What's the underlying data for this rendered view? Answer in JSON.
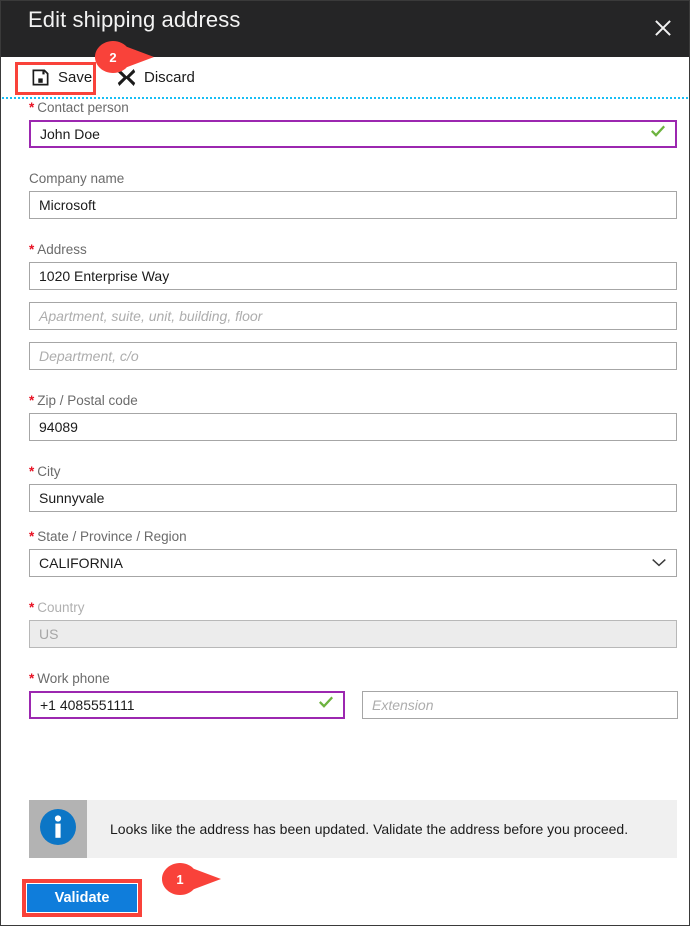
{
  "window": {
    "title": "Edit shipping address",
    "close_icon": "close-icon"
  },
  "toolbar": {
    "save_label": "Save",
    "save_icon": "save-floppy-icon",
    "discard_label": "Discard",
    "discard_icon": "close-x-icon"
  },
  "form": {
    "fields": [
      {
        "label": "Contact person",
        "required": true,
        "value": "John Doe",
        "placeholder": "",
        "state": "modified",
        "valid": true
      },
      {
        "label": "Company name",
        "required": false,
        "value": "Microsoft",
        "placeholder": "",
        "state": "normal",
        "valid": false
      },
      {
        "label": "Address",
        "required": true,
        "value": "1020 Enterprise Way",
        "placeholder": "",
        "state": "normal",
        "valid": false
      },
      {
        "label": "",
        "required": false,
        "value": "",
        "placeholder": "Apartment, suite, unit, building, floor",
        "state": "normal",
        "valid": false
      },
      {
        "label": "",
        "required": false,
        "value": "",
        "placeholder": "Department, c/o",
        "state": "normal",
        "valid": false
      },
      {
        "label": "Zip / Postal code",
        "required": true,
        "value": "94089",
        "placeholder": "",
        "state": "normal",
        "valid": false
      },
      {
        "label": "City",
        "required": true,
        "value": "Sunnyvale",
        "placeholder": "",
        "state": "normal",
        "valid": false
      },
      {
        "label": "State / Province / Region",
        "required": true,
        "value": "CALIFORNIA",
        "placeholder": "",
        "state": "dropdown",
        "valid": false
      },
      {
        "label": "Country",
        "required": true,
        "value": "US",
        "placeholder": "",
        "state": "disabled",
        "valid": false
      }
    ],
    "phone": {
      "label": "Work phone",
      "required": true,
      "value": "+1 4085551111",
      "valid": true,
      "extension_placeholder": "Extension"
    }
  },
  "info": {
    "icon": "info-circle-icon",
    "message": "Looks like the address has been updated. Validate the address before you proceed."
  },
  "actions": {
    "validate_label": "Validate"
  },
  "callouts": [
    {
      "number": "1"
    },
    {
      "number": "2"
    }
  ],
  "colors": {
    "titlebar_bg": "#252526",
    "accent_blue": "#0f7ddb",
    "highlight_red": "#f9423a",
    "required_red": "#e81123",
    "modified_purple": "#9c27b0",
    "valid_green": "#6db33f",
    "info_blue": "#0c76c6",
    "dotted_cyan": "#18bef5"
  }
}
